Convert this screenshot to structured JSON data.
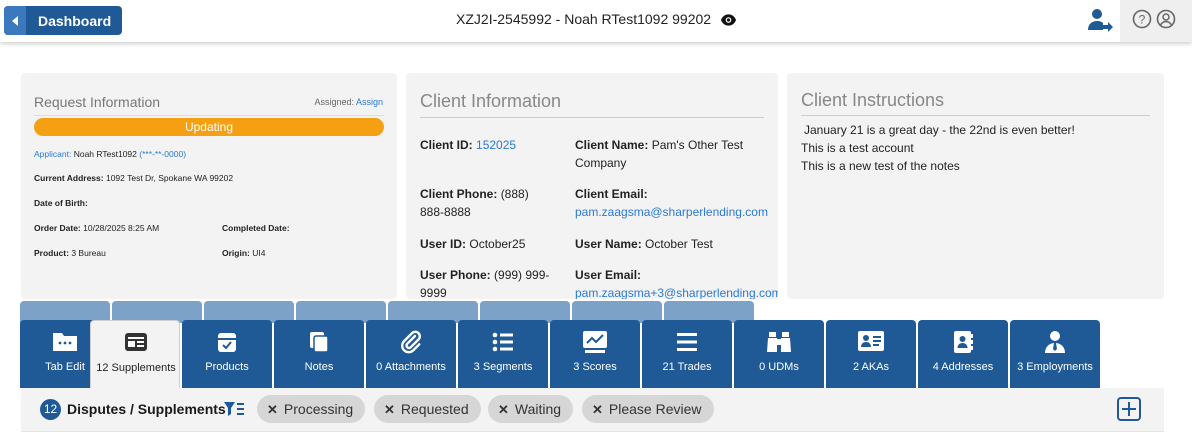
{
  "header": {
    "dashboard_label": "Dashboard",
    "title": "XZJ2I-2545992 - Noah RTest1092 99202",
    "icons": [
      "eye-icon",
      "user-share-icon",
      "help-icon",
      "account-icon"
    ]
  },
  "request_info": {
    "title": "Request Information",
    "assigned_label": "Assigned:",
    "assign_link": "Assign",
    "status": "Updating",
    "status_color": "#f4a012",
    "applicant_label": "Applicant:",
    "applicant_name": "Noah RTest1092",
    "applicant_ssn": "(***-**-0000)",
    "current_address_label": "Current Address:",
    "current_address": "1092 Test Dr, Spokane WA 99202",
    "dob_label": "Date of Birth:",
    "dob": "",
    "order_date_label": "Order Date:",
    "order_date": "10/28/2025 8:25 AM",
    "completed_date_label": "Completed Date:",
    "completed_date": "",
    "product_label": "Product:",
    "product": "3 Bureau",
    "origin_label": "Origin:",
    "origin": "UI4"
  },
  "client_info": {
    "title": "Client Information",
    "client_id_label": "Client ID:",
    "client_id": "152025",
    "client_name_label": "Client Name:",
    "client_name_1": "Pam's Other Test",
    "client_name_2": "Company",
    "client_phone_label": "Client Phone:",
    "client_phone_1": "(888)",
    "client_phone_2": "888-8888",
    "client_email_label": "Client Email:",
    "client_email": "pam.zaagsma@sharperlending.com",
    "user_id_label": "User ID:",
    "user_id": "October25",
    "user_name_label": "User Name:",
    "user_name": "October Test",
    "user_phone_label": "User Phone:",
    "user_phone_1": "(999) 999-",
    "user_phone_2": "9999",
    "user_email_label": "User Email:",
    "user_email": "pam.zaagsma+3@sharperlending.com"
  },
  "client_instructions": {
    "title": "Client Instructions",
    "lines": [
      "January 21 is a great day - the 22nd is even better!",
      "This is a test account",
      "This is a new test of the notes"
    ]
  },
  "tabs": [
    {
      "label": "Tab Edit",
      "icon": "folder-icon"
    },
    {
      "label": "12 Supplements",
      "icon": "supplements-icon",
      "active": true
    },
    {
      "label": "Products",
      "icon": "products-icon"
    },
    {
      "label": "Notes",
      "icon": "notes-icon"
    },
    {
      "label": "0 Attachments",
      "icon": "paperclip-icon"
    },
    {
      "label": "3 Segments",
      "icon": "list-icon"
    },
    {
      "label": "3 Scores",
      "icon": "scores-icon"
    },
    {
      "label": "21 Trades",
      "icon": "trades-icon"
    },
    {
      "label": "0 UDMs",
      "icon": "binoculars-icon"
    },
    {
      "label": "2 AKAs",
      "icon": "id-card-icon"
    },
    {
      "label": "4 Addresses",
      "icon": "address-book-icon"
    },
    {
      "label": "3 Employments",
      "icon": "employee-icon"
    }
  ],
  "filter_bar": {
    "count": "12",
    "title": "Disputes / Supplements",
    "chips": [
      "Processing",
      "Requested",
      "Waiting",
      "Please Review"
    ],
    "chip_close": "✕"
  },
  "colors": {
    "primary": "#1f5a96",
    "link": "#2a7ad6",
    "panel": "#f3f3f3",
    "status": "#f4a012"
  }
}
